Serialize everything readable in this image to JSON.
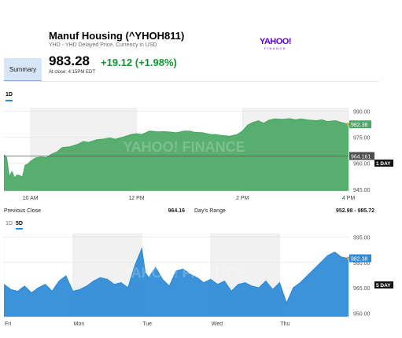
{
  "header": {
    "title": "Manuf Housing (^YHOH811)",
    "subtitle": "YHD - YHD Delayed Price. Currency in USD",
    "logo_main": "YAHOO!",
    "logo_sub": "FINANCE",
    "summary_tab": "Summary"
  },
  "quote": {
    "price": "983.28",
    "change": "+19.12 (+1.98%)",
    "close_time": "At close: 4:15PM EDT",
    "change_color": "#109933"
  },
  "stats": {
    "previous_close_label": "Previous Close",
    "previous_close_value": "964.16",
    "days_range_label": "Day's Range",
    "days_range_value": "952.98 - 985.72"
  },
  "intraday_chart": {
    "range_tab": "1D",
    "watermark": "YAHOO! FINANCE",
    "current_label": "982.38",
    "prev_close_label": "964.161",
    "badge": "1 DAY",
    "color": "#4aa864",
    "chart_data": {
      "type": "area",
      "x_labels": [
        "10 AM",
        "12 PM",
        "2 PM",
        "4 PM"
      ],
      "y_ticks": [
        945.0,
        960.0,
        975.0,
        990.0
      ],
      "y_tick_labels": [
        "945.00",
        "960.00",
        "975.00",
        "990.00"
      ],
      "ylim": [
        944,
        992
      ],
      "reference_line": 964.16,
      "series": [
        {
          "x": [
            9.5,
            9.55,
            9.6,
            9.65,
            9.7,
            9.75,
            9.8,
            9.85,
            9.9,
            9.95,
            10.0,
            10.1,
            10.2,
            10.3,
            10.4,
            10.5,
            10.6,
            10.75,
            10.9,
            11.0,
            11.1,
            11.25,
            11.4,
            11.5,
            11.6,
            11.75,
            11.9,
            12.0,
            12.1,
            12.25,
            12.4,
            12.5,
            12.6,
            12.75,
            12.9,
            13.0,
            13.1,
            13.25,
            13.4,
            13.5,
            13.6,
            13.75,
            13.9,
            14.0,
            14.1,
            14.2,
            14.3,
            14.4,
            14.5,
            14.6,
            14.75,
            14.9,
            15.0,
            15.1,
            15.25,
            15.4,
            15.5,
            15.6,
            15.75,
            15.9,
            16.0
          ],
          "y": [
            964.8,
            963.2,
            952.0,
            955.0,
            951.5,
            953.2,
            952.8,
            952.0,
            958.8,
            959.5,
            961.0,
            963.0,
            963.5,
            963.2,
            965.2,
            966.5,
            969.0,
            969.5,
            971.0,
            972.5,
            972.0,
            973.5,
            974.0,
            974.5,
            973.8,
            975.0,
            976.5,
            977.0,
            976.5,
            978.5,
            978.0,
            978.2,
            978.0,
            977.5,
            978.5,
            978.5,
            977.8,
            977.5,
            976.5,
            976.5,
            976.0,
            975.5,
            976.5,
            978.5,
            982.0,
            983.5,
            984.5,
            983.0,
            984.8,
            985.5,
            985.3,
            985.6,
            985.0,
            985.5,
            984.8,
            984.5,
            985.0,
            984.0,
            984.5,
            983.2,
            982.4
          ]
        }
      ]
    }
  },
  "five_day_chart": {
    "range_tabs": [
      "1D",
      "5D"
    ],
    "watermark": "YAHOO! FINANCE",
    "current_label": "982.38",
    "badge": "5 DAY",
    "color": "#2c8ad6",
    "chart_data": {
      "type": "area",
      "x_labels": [
        "Fri",
        "Mon",
        "Tue",
        "Wed",
        "Thu"
      ],
      "y_ticks": [
        950.0,
        965.0,
        980.0,
        995.0
      ],
      "y_tick_labels": [
        "950.00",
        "965.00",
        "980.00",
        "995.00"
      ],
      "ylim": [
        948,
        997
      ],
      "series": [
        {
          "x": [
            0,
            0.1,
            0.2,
            0.3,
            0.4,
            0.5,
            0.6,
            0.7,
            0.8,
            0.9,
            1.0,
            1.1,
            1.2,
            1.3,
            1.4,
            1.5,
            1.6,
            1.7,
            1.8,
            1.9,
            2.0,
            2.05,
            2.1,
            2.2,
            2.3,
            2.4,
            2.5,
            2.6,
            2.7,
            2.8,
            2.9,
            3.0,
            3.1,
            3.2,
            3.3,
            3.4,
            3.5,
            3.6,
            3.7,
            3.8,
            3.9,
            4.0,
            4.1,
            4.2,
            4.3,
            4.4,
            4.5,
            4.6,
            4.7,
            4.8,
            4.9,
            5.0
          ],
          "y": [
            967,
            964,
            963,
            966,
            962,
            965,
            967,
            963,
            969,
            972,
            963,
            964,
            966,
            969,
            971,
            970,
            967,
            968,
            965,
            978,
            988,
            974,
            971,
            977,
            970,
            966,
            975,
            976,
            973,
            971,
            968,
            970,
            967,
            969,
            963,
            967,
            968,
            966,
            965,
            969,
            964,
            968,
            956,
            965,
            968,
            972,
            976,
            980,
            984,
            986,
            983,
            982.4
          ]
        }
      ]
    }
  }
}
